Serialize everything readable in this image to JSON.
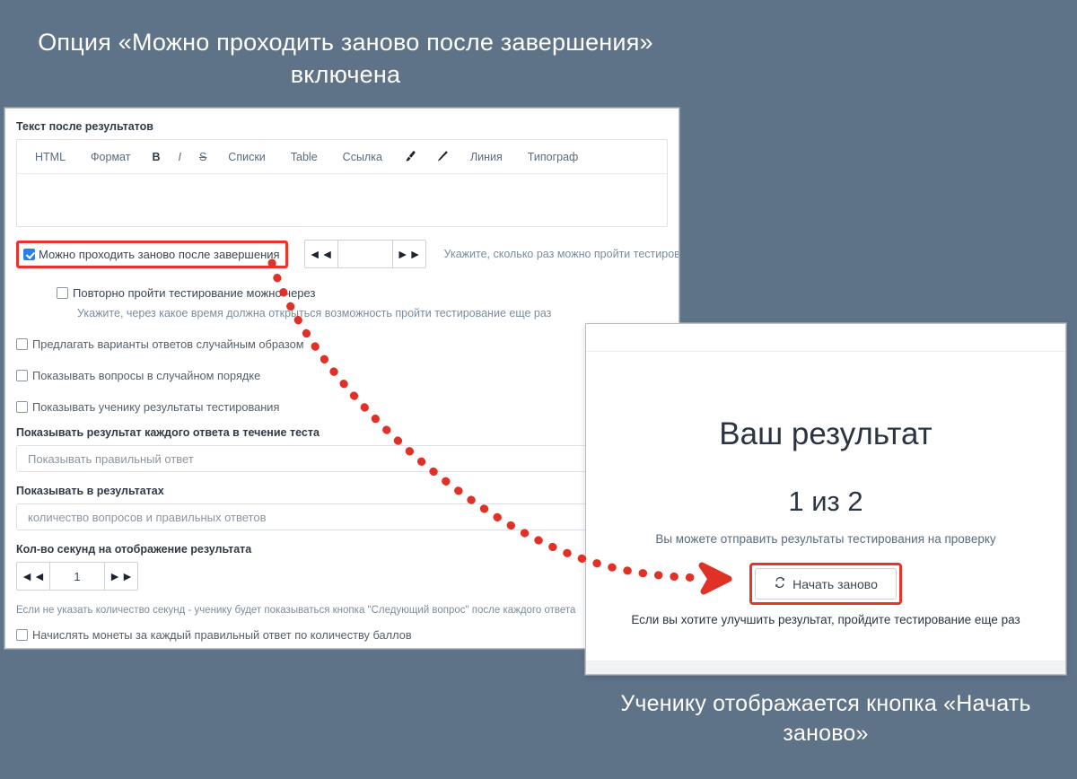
{
  "captions": {
    "top": "Опция «Можно проходить заново после завершения» включена",
    "bottom": "Ученику отображается кнопка «Начать заново»"
  },
  "colors": {
    "background": "#5f7388",
    "highlight": "#e8342a",
    "checkbox_checked": "#2a7fe8",
    "panel": "#ffffff",
    "muted_text": "#7c8c9c"
  },
  "settings_panel": {
    "editor": {
      "label": "Текст после результатов",
      "toolbar": [
        {
          "label": "HTML",
          "icon": "html-icon"
        },
        {
          "label": "Формат",
          "icon": "format-icon"
        },
        {
          "label": "B",
          "icon": "bold-icon"
        },
        {
          "label": "I",
          "icon": "italic-icon"
        },
        {
          "label": "S",
          "icon": "strikethrough-icon"
        },
        {
          "label": "Списки",
          "icon": "lists-icon"
        },
        {
          "label": "Table",
          "icon": "table-icon"
        },
        {
          "label": "Ссылка",
          "icon": "link-icon"
        },
        {
          "label": "",
          "icon": "brush-icon"
        },
        {
          "label": "",
          "icon": "pencil-icon"
        },
        {
          "label": "Линия",
          "icon": "line-icon"
        },
        {
          "label": "Типограф",
          "icon": "typograf-icon"
        }
      ],
      "content": ""
    },
    "retake": {
      "checkbox_label": "Можно проходить заново после завершения",
      "checked": true,
      "stepper_value": "",
      "stepper_prev_icon": "double-chevron-left-icon",
      "stepper_next_icon": "double-chevron-right-icon",
      "hint": "Укажите, сколько раз можно пройти тестирование"
    },
    "retake_delay": {
      "checkbox_label": "Повторно пройти тестирование можно через",
      "checked": false,
      "hint": "Укажите, через какое время должна открыться возможность пройти тестирование еще раз"
    },
    "options": [
      {
        "label": "Предлагать варианты ответов случайным образом",
        "checked": false
      },
      {
        "label": "Показывать вопросы в случайном порядке",
        "checked": false
      },
      {
        "label": "Показывать ученику результаты тестирования",
        "checked": false
      }
    ],
    "answer_result": {
      "label": "Показывать результат каждого ответа в течение теста",
      "value": "Показывать правильный ответ"
    },
    "show_in_results": {
      "label": "Показывать в результатах",
      "value": "количество вопросов и правильных ответов"
    },
    "seconds": {
      "label": "Кол-во секунд на отображение результата",
      "value": "1",
      "prev_icon": "double-chevron-left-icon",
      "next_icon": "double-chevron-right-icon",
      "note": "Если не указать количество секунд - ученику будет показываться кнопка \"Следующий вопрос\" после каждого ответа"
    },
    "coins": {
      "label": "Начислять монеты за каждый правильный ответ по количеству баллов",
      "checked": false
    }
  },
  "result_panel": {
    "title": "Ваш результат",
    "score": "1 из 2",
    "subtext": "Вы можете отправить результаты тестирования на проверку",
    "restart_button": {
      "label": "Начать заново",
      "icon": "refresh-icon"
    },
    "hint": "Если вы хотите улучшить результат, пройдите тестирование еще раз"
  }
}
